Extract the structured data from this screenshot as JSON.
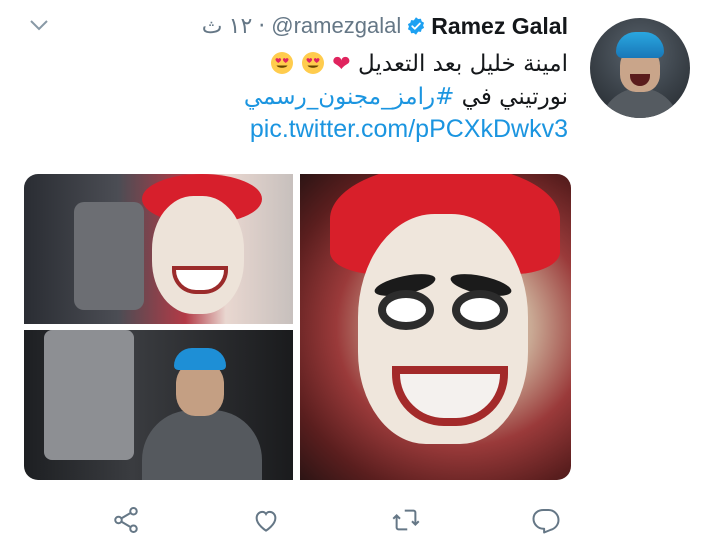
{
  "tweet": {
    "author_name": "Ramez Galal",
    "handle": "@ramezgalal",
    "separator": "·",
    "time": "١٢ ث",
    "text_line1": "امينة خليل بعد التعديل",
    "text_line1_emojis": [
      "heart",
      "heart-eyes",
      "heart-eyes"
    ],
    "text_line2_prefix": "نورتيني في",
    "hashtag": "#رامز_مجنون_رسمي",
    "pic_link": "pic.twitter.com/pPCXkDwkv3"
  },
  "icons": {
    "verified": "verified-badge-icon",
    "caret": "chevron-down-icon",
    "share": "share-icon",
    "like": "heart-outline-icon",
    "retweet": "retweet-icon",
    "reply": "reply-icon"
  },
  "colors": {
    "link": "#1b95e0",
    "verified": "#1da1f2",
    "muted": "#657786",
    "heart": "#e0245e"
  }
}
